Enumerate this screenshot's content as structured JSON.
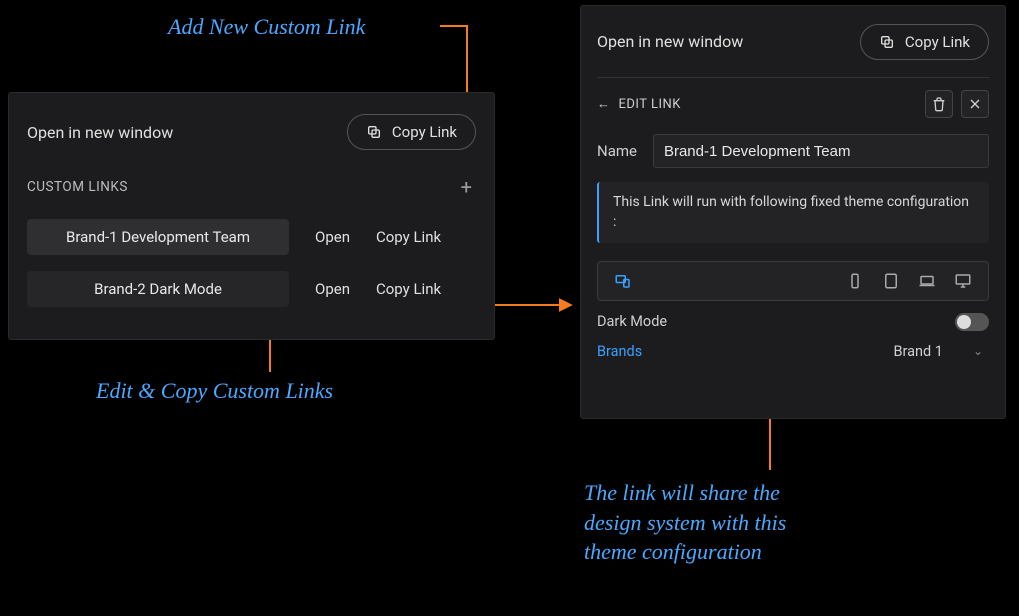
{
  "annotations": {
    "top": "Add New Custom Link",
    "left": "Edit & Copy Custom Links",
    "bottom": "The link will share the\ndesign system with this\ntheme configuration"
  },
  "leftPanel": {
    "openLabel": "Open in new window",
    "copyLabel": "Copy  Link",
    "sectionTitle": "CUSTOM LINKS",
    "addTooltip": "+",
    "links": [
      {
        "name": "Brand-1 Development Team",
        "open": "Open",
        "copy": "Copy Link"
      },
      {
        "name": "Brand-2 Dark Mode",
        "open": "Open",
        "copy": "Copy Link"
      }
    ]
  },
  "rightPanel": {
    "openLabel": "Open in new window",
    "copyLabel": "Copy  Link",
    "editTitle": "EDIT LINK",
    "nameLabel": "Name",
    "nameValue": "Brand-1 Development Team",
    "infoText": "This Link will run with following fixed theme configuration :",
    "darkModeLabel": "Dark Mode",
    "darkModeOn": false,
    "brandsLabel": "Brands",
    "brandSelected": "Brand 1",
    "devices": {
      "active": "responsive",
      "options": [
        "responsive",
        "phone",
        "tablet",
        "laptop",
        "desktop"
      ]
    }
  },
  "colors": {
    "accent": "#3aa0ff",
    "callout": "#f47c20"
  }
}
